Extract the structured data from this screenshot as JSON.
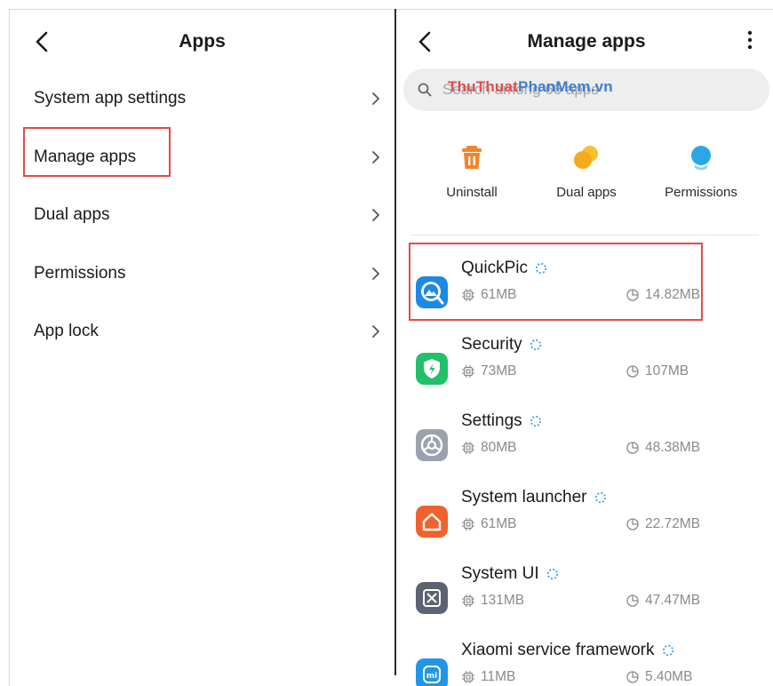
{
  "left_panel": {
    "title": "Apps",
    "items": [
      {
        "label": "System app settings"
      },
      {
        "label": "Manage apps"
      },
      {
        "label": "Dual apps"
      },
      {
        "label": "Permissions"
      },
      {
        "label": "App lock"
      }
    ]
  },
  "right_panel": {
    "title": "Manage apps",
    "search": {
      "placeholder": "Search among 66 apps"
    },
    "watermark": {
      "part1": "ThuThuat",
      "part2": "PhanMem",
      "part3": ".vn"
    },
    "quick_actions": [
      {
        "label": "Uninstall",
        "icon": "trash-icon",
        "color": "#f5832a"
      },
      {
        "label": "Dual apps",
        "icon": "dual-apps-icon",
        "color": "#f9b21c"
      },
      {
        "label": "Permissions",
        "icon": "permissions-icon",
        "color": "#2aa8e6"
      }
    ],
    "apps": [
      {
        "name": "QuickPic",
        "ram": "61MB",
        "storage": "14.82MB",
        "icon": "quickpic-icon"
      },
      {
        "name": "Security",
        "ram": "73MB",
        "storage": "107MB",
        "icon": "security-shield-icon"
      },
      {
        "name": "Settings",
        "ram": "80MB",
        "storage": "48.38MB",
        "icon": "settings-gear-icon"
      },
      {
        "name": "System launcher",
        "ram": "61MB",
        "storage": "22.72MB",
        "icon": "home-icon"
      },
      {
        "name": "System UI",
        "ram": "131MB",
        "storage": "47.47MB",
        "icon": "system-ui-icon"
      },
      {
        "name": "Xiaomi service framework",
        "ram": "11MB",
        "storage": "5.40MB",
        "icon": "mi-icon"
      }
    ]
  },
  "colors": {
    "highlight": "#e14b4b",
    "secondary_text": "#8a8a8a",
    "spinner": "#3aa0e8"
  }
}
